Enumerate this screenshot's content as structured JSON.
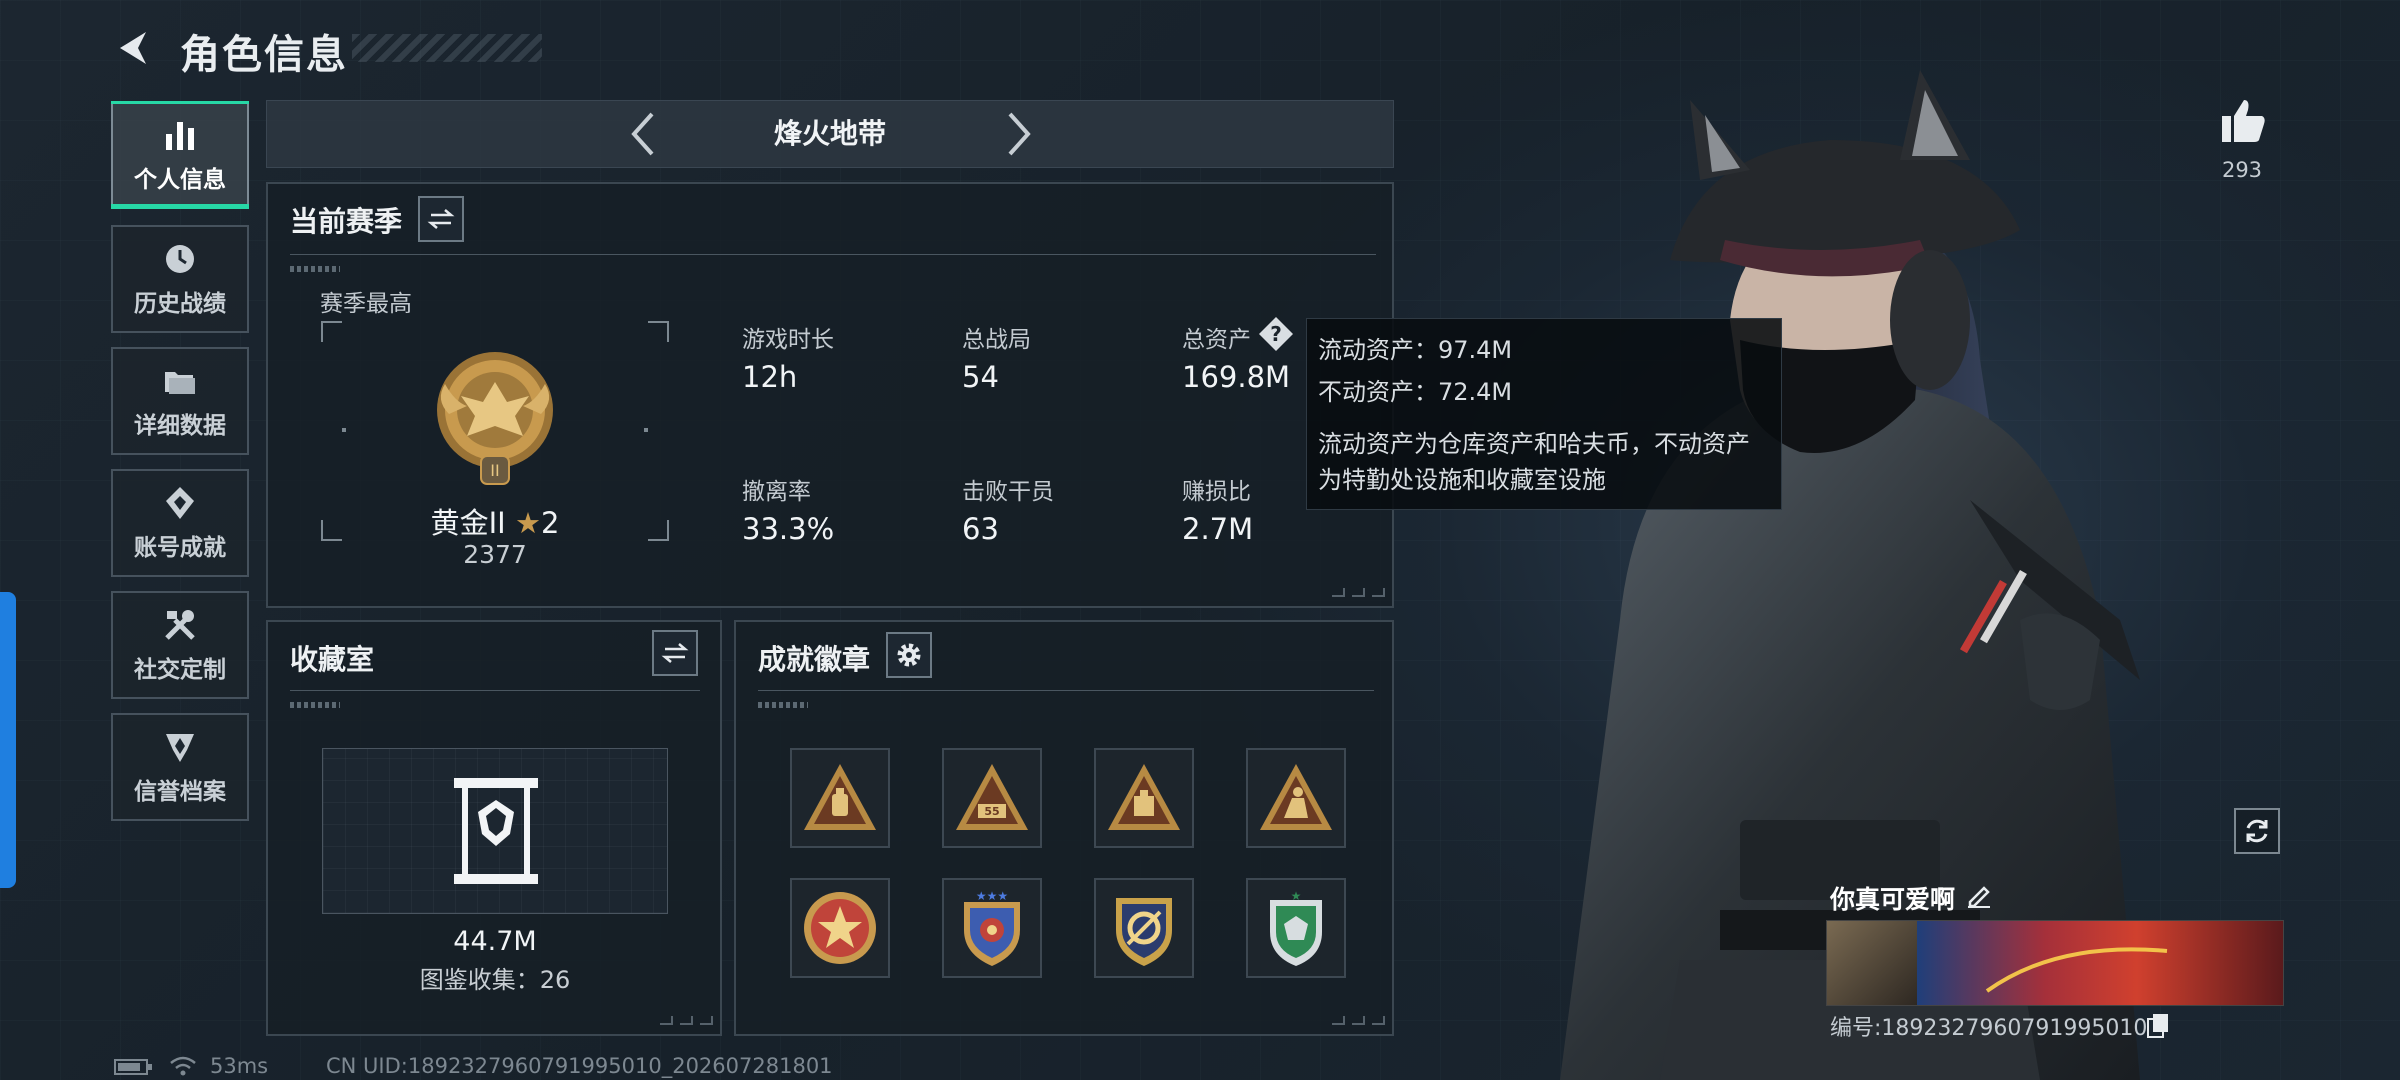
{
  "header": {
    "title": "角色信息",
    "back_icon": "back-arrow-icon"
  },
  "nav": {
    "items": [
      {
        "label": "个人信息",
        "icon": "bar-chart-icon",
        "active": true
      },
      {
        "label": "历史战绩",
        "icon": "clock-icon"
      },
      {
        "label": "详细数据",
        "icon": "folder-icon"
      },
      {
        "label": "账号成就",
        "icon": "achievement-icon"
      },
      {
        "label": "社交定制",
        "icon": "tools-icon"
      },
      {
        "label": "信誉档案",
        "icon": "shield-icon"
      }
    ]
  },
  "mode": {
    "title": "烽火地带"
  },
  "season": {
    "title": "当前赛季",
    "best_label": "赛季最高",
    "rank_name": "黄金II",
    "rank_stars": "2",
    "rank_points": "2377",
    "stats": [
      {
        "label": "游戏时长",
        "value": "12h"
      },
      {
        "label": "总战局",
        "value": "54"
      },
      {
        "label": "总资产",
        "value": "169.8M"
      },
      {
        "label": "撤离率",
        "value": "33.3%"
      },
      {
        "label": "击败干员",
        "value": "63"
      },
      {
        "label": "赚损比",
        "value": "2.7M"
      }
    ]
  },
  "tooltip": {
    "liquid": "流动资产：97.4M",
    "fixed": "不动资产：72.4M",
    "desc_line1": "流动资产为仓库资产和哈夫币，不动资产",
    "desc_line2": "为特勤处设施和收藏室设施"
  },
  "collection": {
    "title": "收藏室",
    "value": "44.7M",
    "count_text": "图鉴收集：26"
  },
  "achievements": {
    "title": "成就徽章",
    "badges": [
      {
        "icon": "badge-triangle-bag-icon",
        "color": "#b78a43"
      },
      {
        "icon": "badge-triangle-55-icon",
        "color": "#b78a43"
      },
      {
        "icon": "badge-triangle-box-icon",
        "color": "#b78a43"
      },
      {
        "icon": "badge-triangle-figure-icon",
        "color": "#b78a43"
      },
      {
        "icon": "badge-round-star-icon",
        "color": "#c0443a"
      },
      {
        "icon": "badge-shield-stars-icon",
        "color": "#3d5db0"
      },
      {
        "icon": "badge-shield-ring-icon",
        "color": "#c9a24a"
      },
      {
        "icon": "badge-shield-green-icon",
        "color": "#2f8a55"
      }
    ]
  },
  "profile": {
    "likes": "293",
    "name": "你真可爱啊",
    "id_text": "编号:1892327960791995010"
  },
  "footer": {
    "ping": "53ms",
    "uid": "CN UID:1892327960791995010_202607281801"
  },
  "colors": {
    "accent": "#27d8a6",
    "side_tab": "#1f7fe0",
    "gold": "#c89a4e"
  }
}
